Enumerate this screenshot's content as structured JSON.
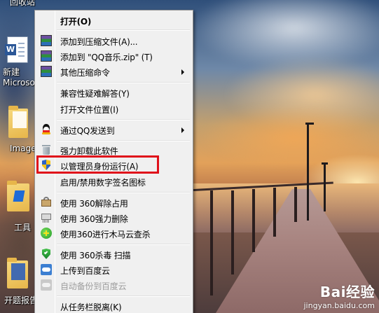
{
  "desktop": {
    "icons": [
      {
        "label": "回收站"
      },
      {
        "label": "新建\nMicrosof"
      },
      {
        "label": "Image"
      },
      {
        "label": "工具"
      },
      {
        "label": "开题报告"
      }
    ]
  },
  "context_menu": {
    "items": [
      {
        "label": "打开(O)",
        "icon": "",
        "bold": true
      },
      {
        "label": "添加到压缩文件(A)...",
        "icon": "winrar-icon"
      },
      {
        "label": "添加到 \"QQ音乐.zip\" (T)",
        "icon": "winrar-icon"
      },
      {
        "label": "其他压缩命令",
        "icon": "winrar-icon",
        "submenu": true
      },
      {
        "label": "兼容性疑难解答(Y)",
        "icon": ""
      },
      {
        "label": "打开文件位置(I)",
        "icon": ""
      },
      {
        "label": "通过QQ发送到",
        "icon": "qq-penguin-icon",
        "submenu": true
      },
      {
        "label": "强力卸载此软件",
        "icon": "trash-can-icon"
      },
      {
        "label": "以管理员身份运行(A)",
        "icon": "uac-shield-icon",
        "highlighted": true
      },
      {
        "label": "启用/禁用数字签名图标",
        "icon": ""
      },
      {
        "label": "使用 360解除占用",
        "icon": "360-unlock-icon"
      },
      {
        "label": "使用 360强力删除",
        "icon": "360-shred-icon"
      },
      {
        "label": "使用360进行木马云查杀",
        "icon": "360-trojan-icon"
      },
      {
        "label": "使用 360杀毒 扫描",
        "icon": "360-antivirus-icon"
      },
      {
        "label": "上传到百度云",
        "icon": "baidu-cloud-icon"
      },
      {
        "label": "自动备份到百度云",
        "icon": "baidu-cloud-icon",
        "disabled": true
      },
      {
        "label": "从任务栏脱离(K)",
        "icon": ""
      }
    ],
    "highlight_color": "#e0101a"
  },
  "watermark": {
    "brand": "Bai经验",
    "url": "jingyan.baidu.com"
  }
}
